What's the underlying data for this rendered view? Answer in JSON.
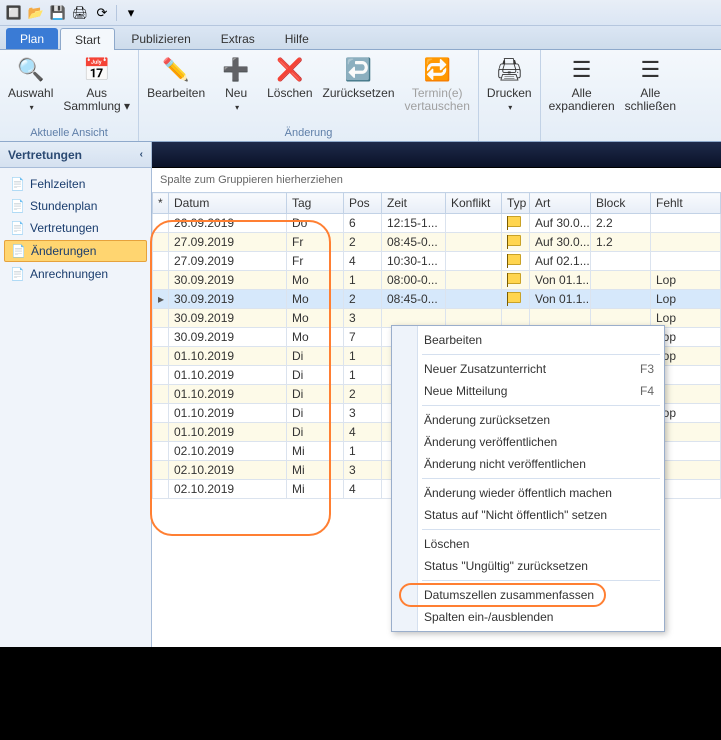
{
  "qat": {
    "arrow": "▾"
  },
  "tabs": {
    "plan": "Plan",
    "start": "Start",
    "publizieren": "Publizieren",
    "extras": "Extras",
    "hilfe": "Hilfe"
  },
  "ribbon": {
    "auswahl": {
      "label": "Auswahl",
      "sub": "▾"
    },
    "aus_sammlung": {
      "line1": "Aus",
      "line2": "Sammlung ▾"
    },
    "aktuelle": "Aktuelle Ansicht",
    "bearbeiten": "Bearbeiten",
    "neu": {
      "label": "Neu",
      "sub": "▾"
    },
    "loeschen": "Löschen",
    "zuruecksetzen": "Zurücksetzen",
    "termine": {
      "line1": "Termin(e)",
      "line2": "vertauschen"
    },
    "aenderung": "Änderung",
    "drucken": {
      "label": "Drucken",
      "sub": "▾"
    },
    "expandieren": {
      "line1": "Alle",
      "line2": "expandieren"
    },
    "schliessen": {
      "line1": "Alle",
      "line2": "schließen"
    }
  },
  "sidebar": {
    "header": "Vertretungen",
    "items": [
      {
        "label": "Fehlzeiten"
      },
      {
        "label": "Stundenplan"
      },
      {
        "label": "Vertretungen"
      },
      {
        "label": "Änderungen"
      },
      {
        "label": "Anrechnungen"
      }
    ]
  },
  "group_hint": "Spalte zum Gruppieren hierherziehen",
  "columns": {
    "star": "*",
    "datum": "Datum",
    "tag": "Tag",
    "pos": "Pos",
    "zeit": "Zeit",
    "konflikt": "Konflikt",
    "typ": "Typ",
    "art": "Art",
    "block": "Block",
    "fehlt": "Fehlt"
  },
  "rows": [
    {
      "mark": "",
      "datum": "26.09.2019",
      "tag": "Do",
      "pos": "6",
      "zeit": "12:15-1...",
      "konflikt": "",
      "typ": "flag",
      "art": "Auf 30.0...",
      "block": "2.2",
      "fehlt": ""
    },
    {
      "mark": "",
      "datum": "27.09.2019",
      "tag": "Fr",
      "pos": "2",
      "zeit": "08:45-0...",
      "konflikt": "",
      "typ": "flag",
      "art": "Auf 30.0...",
      "block": "1.2",
      "fehlt": ""
    },
    {
      "mark": "",
      "datum": "27.09.2019",
      "tag": "Fr",
      "pos": "4",
      "zeit": "10:30-1...",
      "konflikt": "",
      "typ": "flag",
      "art": "Auf 02.1...",
      "block": "",
      "fehlt": ""
    },
    {
      "mark": "",
      "datum": "30.09.2019",
      "tag": "Mo",
      "pos": "1",
      "zeit": "08:00-0...",
      "konflikt": "",
      "typ": "flag",
      "art": "Von 01.1...",
      "block": "",
      "fehlt": "Lop"
    },
    {
      "mark": "▸",
      "datum": "30.09.2019",
      "tag": "Mo",
      "pos": "2",
      "zeit": "08:45-0...",
      "konflikt": "",
      "typ": "flag",
      "art": "Von 01.1...",
      "block": "",
      "fehlt": "Lop",
      "current": true
    },
    {
      "mark": "",
      "datum": "30.09.2019",
      "tag": "Mo",
      "pos": "3",
      "zeit": "",
      "konflikt": "",
      "typ": "",
      "art": "",
      "block": "",
      "fehlt": "Lop"
    },
    {
      "mark": "",
      "datum": "30.09.2019",
      "tag": "Mo",
      "pos": "7",
      "zeit": "",
      "konflikt": "",
      "typ": "",
      "art": "",
      "block": "",
      "fehlt": "Lop"
    },
    {
      "mark": "",
      "datum": "01.10.2019",
      "tag": "Di",
      "pos": "1",
      "zeit": "",
      "konflikt": "",
      "typ": "",
      "art": "",
      "block": "",
      "fehlt": "Lop"
    },
    {
      "mark": "",
      "datum": "01.10.2019",
      "tag": "Di",
      "pos": "1",
      "zeit": "",
      "konflikt": "",
      "typ": "",
      "art": "",
      "block": "",
      "fehlt": ""
    },
    {
      "mark": "",
      "datum": "01.10.2019",
      "tag": "Di",
      "pos": "2",
      "zeit": "",
      "konflikt": "",
      "typ": "",
      "art": "",
      "block": "",
      "fehlt": ""
    },
    {
      "mark": "",
      "datum": "01.10.2019",
      "tag": "Di",
      "pos": "3",
      "zeit": "",
      "konflikt": "",
      "typ": "",
      "art": "",
      "block": "",
      "fehlt": "Lop"
    },
    {
      "mark": "",
      "datum": "01.10.2019",
      "tag": "Di",
      "pos": "4",
      "zeit": "",
      "konflikt": "",
      "typ": "",
      "art": "",
      "block": "",
      "fehlt": ""
    },
    {
      "mark": "",
      "datum": "02.10.2019",
      "tag": "Mi",
      "pos": "1",
      "zeit": "",
      "konflikt": "",
      "typ": "",
      "art": "",
      "block": "",
      "fehlt": ""
    },
    {
      "mark": "",
      "datum": "02.10.2019",
      "tag": "Mi",
      "pos": "3",
      "zeit": "",
      "konflikt": "",
      "typ": "",
      "art": "",
      "block": "",
      "fehlt": ""
    },
    {
      "mark": "",
      "datum": "02.10.2019",
      "tag": "Mi",
      "pos": "4",
      "zeit": "",
      "konflikt": "",
      "typ": "",
      "art": "",
      "block": "",
      "fehlt": ""
    }
  ],
  "context": [
    {
      "label": "Bearbeiten"
    },
    {
      "sep": true
    },
    {
      "label": "Neuer Zusatzunterricht",
      "shortcut": "F3"
    },
    {
      "label": "Neue Mitteilung",
      "shortcut": "F4"
    },
    {
      "sep": true
    },
    {
      "label": "Änderung zurücksetzen"
    },
    {
      "label": "Änderung veröffentlichen"
    },
    {
      "label": "Änderung nicht veröffentlichen"
    },
    {
      "sep": true
    },
    {
      "label": "Änderung wieder öffentlich machen"
    },
    {
      "label": "Status auf \"Nicht öffentlich\" setzen"
    },
    {
      "sep": true
    },
    {
      "label": "Löschen"
    },
    {
      "label": "Status \"Ungültig\" zurücksetzen"
    },
    {
      "sep": true
    },
    {
      "label": "Datumszellen zusammenfassen"
    },
    {
      "label": "Spalten ein-/ausblenden"
    }
  ]
}
